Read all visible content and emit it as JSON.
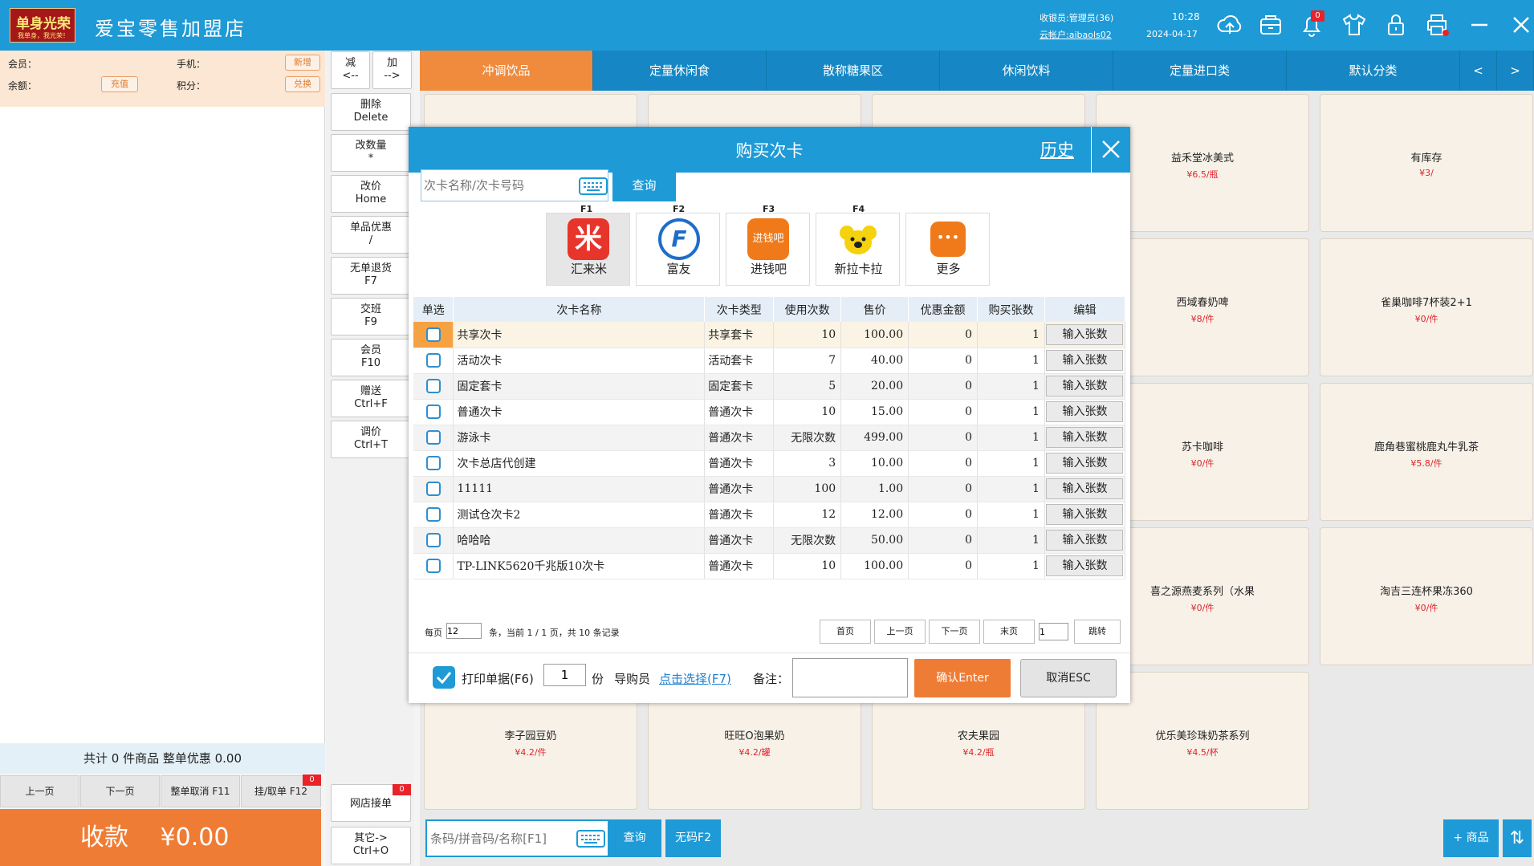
{
  "header": {
    "logo_main": "单身光荣",
    "logo_sub": "我单身，我光荣！",
    "store_name": "爱宝零售加盟店",
    "cashier": "收银员:管理员(36)",
    "cloud_account": "云帐户:aibaols02",
    "time": "10:28",
    "date": "2024-04-17",
    "notification_count": "0"
  },
  "member": {
    "member_label": "会员：",
    "phone_label": "手机：",
    "balance_label": "余额：",
    "points_label": "积分：",
    "add_label": "新增",
    "recharge_label": "充值",
    "exchange_label": "兑换"
  },
  "cart": {
    "total_text": "共计 0 件商品 整单优惠 0.00",
    "prev_page": "上一页",
    "next_page": "下一页",
    "cancel_order": "整单取消 F11",
    "hold_order": "挂/取单 F12",
    "hold_count": "0",
    "pay_label": "收款",
    "pay_amount": "¥0.00"
  },
  "functions": {
    "minus": "减\n<--",
    "plus": "加\n-->",
    "buttons": [
      {
        "label": "删除\nDelete"
      },
      {
        "label": "改数量\n*"
      },
      {
        "label": "改价\nHome"
      },
      {
        "label": "单品优惠\n/"
      },
      {
        "label": "无单退货\nF7"
      },
      {
        "label": "交班\nF9"
      },
      {
        "label": "会员\nF10"
      },
      {
        "label": "赠送\nCtrl+F"
      },
      {
        "label": "调价\nCtrl+T"
      }
    ],
    "online_orders": "网店接单",
    "online_count": "0",
    "other": "其它->\nCtrl+O"
  },
  "categories": [
    "冲调饮品",
    "定量休闲食",
    "散称糖果区",
    "休闲饮料",
    "定量进口类",
    "默认分类"
  ],
  "category_prev": "<",
  "category_next": ">",
  "products": [
    {
      "name": "益禾堂冰美式",
      "price": "¥6.5/瓶"
    },
    {
      "name": "有库存",
      "price": "¥3/"
    },
    {
      "name": "西域春奶啤",
      "price": "¥8/件"
    },
    {
      "name": "雀巢咖啡7杯装2+1",
      "price": "¥0/件"
    },
    {
      "name": "苏卡咖啡",
      "price": "¥0/件"
    },
    {
      "name": "鹿角巷蜜桃鹿丸牛乳茶",
      "price": "¥5.8/件"
    },
    {
      "name": "喜之源燕麦系列（水果",
      "price": "¥0/件"
    },
    {
      "name": "淘吉三连杯果冻360",
      "price": "¥0/件"
    },
    {
      "name": "李子园豆奶",
      "price": "¥4.2/件"
    },
    {
      "name": "旺旺O泡果奶",
      "price": "¥4.2/罐"
    },
    {
      "name": "农夫果园",
      "price": "¥4.2/瓶"
    },
    {
      "name": "优乐美珍珠奶茶系列",
      "price": "¥4.5/杯"
    }
  ],
  "bottom": {
    "search_placeholder": "条码/拼音码/名称[F1]",
    "query": "查询",
    "no_barcode": "无码F2",
    "add_product": "+ 商品",
    "toggle": "⇅"
  },
  "dialog": {
    "title": "购买次卡",
    "history": "历史",
    "search_placeholder": "次卡名称/次卡号码",
    "query": "查询",
    "providers": [
      {
        "key": "F1",
        "name": "汇来米",
        "color": "#e8352c",
        "glyph": "米"
      },
      {
        "key": "F2",
        "name": "富友",
        "color": "#1e6ec8",
        "glyph": "F"
      },
      {
        "key": "F3",
        "name": "进钱吧",
        "color": "#f07a1a",
        "glyph": "进钱吧"
      },
      {
        "key": "F4",
        "name": "新拉卡拉",
        "color": "#f5d20e",
        "glyph": "●"
      },
      {
        "key": "",
        "name": "更多",
        "color": "#f07a1a",
        "glyph": "•••"
      }
    ],
    "columns": [
      "单选",
      "次卡名称",
      "次卡类型",
      "使用次数",
      "售价",
      "优惠金额",
      "购买张数",
      "编辑"
    ],
    "rows": [
      {
        "name": "共享次卡",
        "type": "共享套卡",
        "uses": "10",
        "price": "100.00",
        "discount": "0",
        "qty": "1",
        "edit": "输入张数"
      },
      {
        "name": "活动次卡",
        "type": "活动套卡",
        "uses": "7",
        "price": "40.00",
        "discount": "0",
        "qty": "1",
        "edit": "输入张数"
      },
      {
        "name": "固定套卡",
        "type": "固定套卡",
        "uses": "5",
        "price": "20.00",
        "discount": "0",
        "qty": "1",
        "edit": "输入张数"
      },
      {
        "name": "普通次卡",
        "type": "普通次卡",
        "uses": "10",
        "price": "15.00",
        "discount": "0",
        "qty": "1",
        "edit": "输入张数"
      },
      {
        "name": "游泳卡",
        "type": "普通次卡",
        "uses": "无限次数",
        "price": "499.00",
        "discount": "0",
        "qty": "1",
        "edit": "输入张数"
      },
      {
        "name": "次卡总店代创建",
        "type": "普通次卡",
        "uses": "3",
        "price": "10.00",
        "discount": "0",
        "qty": "1",
        "edit": "输入张数"
      },
      {
        "name": "11111",
        "type": "普通次卡",
        "uses": "100",
        "price": "1.00",
        "discount": "0",
        "qty": "1",
        "edit": "输入张数"
      },
      {
        "name": "测试仓次卡2",
        "type": "普通次卡",
        "uses": "12",
        "price": "12.00",
        "discount": "0",
        "qty": "1",
        "edit": "输入张数"
      },
      {
        "name": "哈哈哈",
        "type": "普通次卡",
        "uses": "无限次数",
        "price": "50.00",
        "discount": "0",
        "qty": "1",
        "edit": "输入张数"
      },
      {
        "name": "TP-LINK5620千兆版10次卡",
        "type": "普通次卡",
        "uses": "10",
        "price": "100.00",
        "discount": "0",
        "qty": "1",
        "edit": "输入张数"
      }
    ],
    "pager": {
      "per_page_label": "每页",
      "per_page": "12",
      "summary": "条，当前 1 / 1 页，共 10 条记录",
      "first": "首页",
      "prev": "上一页",
      "next": "下一页",
      "last": "末页",
      "page": "1",
      "jump": "跳转"
    },
    "footer": {
      "print_label": "打印单据(F6)",
      "copies": "1",
      "copies_unit": "份",
      "guide_label": "导购员",
      "guide_link": "点击选择(F7)",
      "remark_label": "备注：",
      "confirm": "确认Enter",
      "cancel": "取消ESC"
    }
  }
}
